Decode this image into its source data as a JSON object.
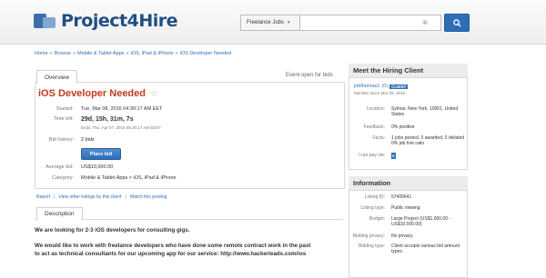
{
  "header": {
    "logo_text": "Project4Hire",
    "search_category": "Freelance Jobs",
    "search_placeholder": ""
  },
  "breadcrumb": [
    "Home",
    "Browse",
    "Mobile & Tablet Apps",
    "iOS, iPad & iPhone",
    "iOS Developer Needed"
  ],
  "overview": {
    "tab_label": "Overview",
    "status": "Event open for bids",
    "title": "iOS Developer Needed",
    "started_label": "Started:",
    "started_value": "Tue, Mar 08, 2016 04:30:17 AM EET",
    "time_left_label": "Time left:",
    "time_left_value": "29d, 15h, 31m, 7s",
    "ends_value": "Ends: Thu, Apr 07, 2016 05:30:17 AM EEST",
    "bid_history_label": "Bid history:",
    "bid_history_value": "2 bids",
    "place_bid_label": "Place bid",
    "average_bid_label": "Average bid:",
    "average_bid_value": "US$10,000.00",
    "category_label": "Category:",
    "category_value": "Mobile & Tablet Apps > iOS, iPad & iPhone"
  },
  "actions": {
    "report": "Report",
    "view_other": "View other listings by this client",
    "watch": "Watch this posting"
  },
  "description": {
    "tab_label": "Description",
    "line1": "We are looking for 2-3 iOS developers for consulting gigs.",
    "line2": "We would like to work with freelance developers who have done some remote contract work in the past",
    "line3": "to act as technical consultants for our upcoming app for our service:  http://www.hackerleads.com/ios"
  },
  "client": {
    "heading": "Meet the Hiring Client",
    "username": "jobthomas1",
    "score": "(0)",
    "badge": "CLIENT",
    "member_since": "Member since Mar 06, 2016",
    "location_label": "Location:",
    "location_value": "Sylmar, New York, 10001, United States",
    "feedback_label": "Feedback:",
    "feedback_value": "0% positive",
    "facts_label": "Facts:",
    "facts_value1": "1 jobs posted, 0 awarded, 0 delisted",
    "facts_value2": "0% job hire ratio",
    "pay_label": "I can pay via:",
    "pay_icon_letter": "E"
  },
  "information": {
    "heading": "Information",
    "listing_id_label": "Listing ID:",
    "listing_id_value": "57400641",
    "listing_type_label": "Listing type:",
    "listing_type_value": "Public viewing",
    "budget_label": "Budget:",
    "budget_value": "Large Project (US$1,000.00 - US$10,000.00)",
    "bidding_privacy_label": "Bidding privacy:",
    "bidding_privacy_value": "No privacy",
    "bidding_type_label": "Bidding type:",
    "bidding_type_value": "Client accepts various bid amount types"
  }
}
